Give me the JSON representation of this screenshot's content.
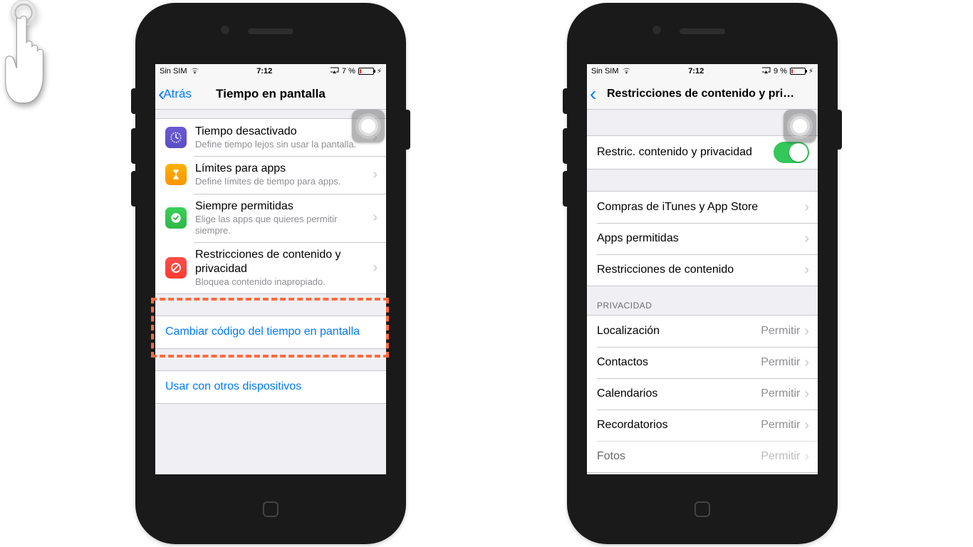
{
  "phone1": {
    "statusbar": {
      "carrier": "Sin SIM",
      "time": "7:12",
      "battery_pct": "7 %"
    },
    "nav": {
      "back": "Atrás",
      "title": "Tiempo en pantalla"
    },
    "items": [
      {
        "title": "Tiempo desactivado",
        "subtitle": "Define tiempo lejos sin usar la pantalla."
      },
      {
        "title": "Límites para apps",
        "subtitle": "Define límites de tiempo para apps."
      },
      {
        "title": "Siempre permitidas",
        "subtitle": "Elige las apps que quieres permitir siempre."
      },
      {
        "title": "Restricciones de contenido y privacidad",
        "subtitle": "Bloquea contenido inapropiado."
      }
    ],
    "link1": "Cambiar código del tiempo en pantalla",
    "link2": "Usar con otros dispositivos"
  },
  "phone2": {
    "statusbar": {
      "carrier": "Sin SIM",
      "time": "7:12",
      "battery_pct": "9 %"
    },
    "nav": {
      "title": "Restricciones de contenido y pri…"
    },
    "toggleRow": {
      "label": "Restric. contenido y privacidad"
    },
    "groupA": [
      {
        "label": "Compras de iTunes y App Store"
      },
      {
        "label": "Apps permitidas"
      },
      {
        "label": "Restricciones de contenido"
      }
    ],
    "privacyHeader": "PRIVACIDAD",
    "privacy": [
      {
        "label": "Localización",
        "value": "Permitir"
      },
      {
        "label": "Contactos",
        "value": "Permitir"
      },
      {
        "label": "Calendarios",
        "value": "Permitir"
      },
      {
        "label": "Recordatorios",
        "value": "Permitir"
      },
      {
        "label": "Fotos",
        "value": "Permitir"
      }
    ]
  }
}
